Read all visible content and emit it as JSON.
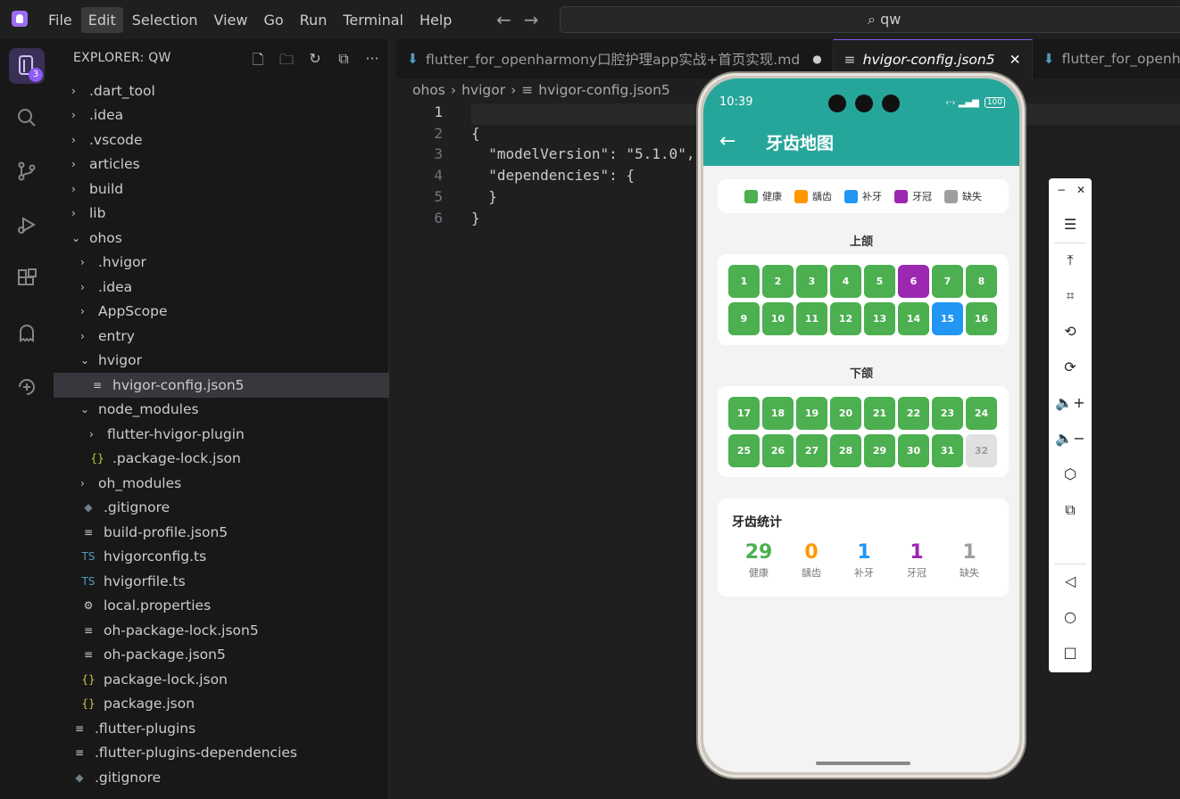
{
  "menu": [
    "File",
    "Edit",
    "Selection",
    "View",
    "Go",
    "Run",
    "Terminal",
    "Help"
  ],
  "search": {
    "value": "qw"
  },
  "activity": {
    "badge": "3"
  },
  "explorer": {
    "title": "EXPLORER: QW",
    "items": [
      {
        "label": ".dart_tool",
        "icon": "",
        "chev": "›"
      },
      {
        "label": ".idea",
        "icon": "",
        "chev": "›"
      },
      {
        "label": ".vscode",
        "icon": "",
        "chev": "›"
      },
      {
        "label": "articles",
        "icon": "",
        "chev": "›"
      },
      {
        "label": "build",
        "icon": "",
        "chev": "›"
      },
      {
        "label": "lib",
        "icon": "",
        "chev": "›"
      },
      {
        "label": "ohos",
        "icon": "",
        "chev": "⌄"
      },
      {
        "label": ".hvigor",
        "icon": "",
        "chev": "›"
      },
      {
        "label": ".idea",
        "icon": "",
        "chev": "›"
      },
      {
        "label": "AppScope",
        "icon": "",
        "chev": "›"
      },
      {
        "label": "entry",
        "icon": "",
        "chev": "›"
      },
      {
        "label": "hvigor",
        "icon": "",
        "chev": "⌄"
      },
      {
        "label": "hvigor-config.json5",
        "icon": "≡",
        "chev": ""
      },
      {
        "label": "node_modules",
        "icon": "",
        "chev": "⌄"
      },
      {
        "label": "flutter-hvigor-plugin",
        "icon": "",
        "chev": "›"
      },
      {
        "label": ".package-lock.json",
        "icon": "{}",
        "chev": ""
      },
      {
        "label": "oh_modules",
        "icon": "",
        "chev": "›"
      },
      {
        "label": ".gitignore",
        "icon": "◆",
        "chev": ""
      },
      {
        "label": "build-profile.json5",
        "icon": "≡",
        "chev": ""
      },
      {
        "label": "hvigorconfig.ts",
        "icon": "TS",
        "chev": ""
      },
      {
        "label": "hvigorfile.ts",
        "icon": "TS",
        "chev": ""
      },
      {
        "label": "local.properties",
        "icon": "⚙",
        "chev": ""
      },
      {
        "label": "oh-package-lock.json5",
        "icon": "≡",
        "chev": ""
      },
      {
        "label": "oh-package.json5",
        "icon": "≡",
        "chev": ""
      },
      {
        "label": "package-lock.json",
        "icon": "{}",
        "chev": ""
      },
      {
        "label": "package.json",
        "icon": "{}",
        "chev": ""
      },
      {
        "label": ".flutter-plugins",
        "icon": "≡",
        "chev": ""
      },
      {
        "label": ".flutter-plugins-dependencies",
        "icon": "≡",
        "chev": ""
      },
      {
        "label": ".gitignore",
        "icon": "◆",
        "chev": ""
      }
    ]
  },
  "tabs": [
    {
      "label": "flutter_for_openharmony口腔护理app实战+首页实现.md",
      "modified": "●"
    },
    {
      "label": "hvigor-config.json5",
      "close": "✕"
    },
    {
      "label": "flutter_for_openharm"
    }
  ],
  "breadcrumb": [
    "ohos",
    "hvigor",
    "hvigor-config.json5"
  ],
  "code": [
    {
      "n": "1",
      "t": ""
    },
    {
      "n": "2",
      "t": "{"
    },
    {
      "n": "3",
      "t": "  \"modelVersion\": \"5.1.0\","
    },
    {
      "n": "4",
      "t": "  \"dependencies\": {"
    },
    {
      "n": "5",
      "t": "  }"
    },
    {
      "n": "6",
      "t": "}"
    }
  ],
  "phone": {
    "time": "10:39",
    "battery": "100",
    "title": "牙齿地图",
    "legend": [
      {
        "label": "健康",
        "color": "#4caf50"
      },
      {
        "label": "龋齿",
        "color": "#ff9800"
      },
      {
        "label": "补牙",
        "color": "#2196f3"
      },
      {
        "label": "牙冠",
        "color": "#9c27b0"
      },
      {
        "label": "缺失",
        "color": "#9e9e9e"
      }
    ],
    "upper_label": "上颌",
    "lower_label": "下颌",
    "upper": [
      {
        "n": "1",
        "s": "healthy"
      },
      {
        "n": "2",
        "s": "healthy"
      },
      {
        "n": "3",
        "s": "healthy"
      },
      {
        "n": "4",
        "s": "healthy"
      },
      {
        "n": "5",
        "s": "healthy"
      },
      {
        "n": "6",
        "s": "crown"
      },
      {
        "n": "7",
        "s": "healthy"
      },
      {
        "n": "8",
        "s": "healthy"
      },
      {
        "n": "9",
        "s": "healthy"
      },
      {
        "n": "10",
        "s": "healthy"
      },
      {
        "n": "11",
        "s": "healthy"
      },
      {
        "n": "12",
        "s": "healthy"
      },
      {
        "n": "13",
        "s": "healthy"
      },
      {
        "n": "14",
        "s": "healthy"
      },
      {
        "n": "15",
        "s": "filled"
      },
      {
        "n": "16",
        "s": "healthy"
      }
    ],
    "lower": [
      {
        "n": "17",
        "s": "healthy"
      },
      {
        "n": "18",
        "s": "healthy"
      },
      {
        "n": "19",
        "s": "healthy"
      },
      {
        "n": "20",
        "s": "healthy"
      },
      {
        "n": "21",
        "s": "healthy"
      },
      {
        "n": "22",
        "s": "healthy"
      },
      {
        "n": "23",
        "s": "healthy"
      },
      {
        "n": "24",
        "s": "healthy"
      },
      {
        "n": "25",
        "s": "healthy"
      },
      {
        "n": "26",
        "s": "healthy"
      },
      {
        "n": "27",
        "s": "healthy"
      },
      {
        "n": "28",
        "s": "healthy"
      },
      {
        "n": "29",
        "s": "healthy"
      },
      {
        "n": "30",
        "s": "healthy"
      },
      {
        "n": "31",
        "s": "healthy"
      },
      {
        "n": "32",
        "s": "missing"
      }
    ],
    "status_colors": {
      "healthy": "#4caf50",
      "crown": "#9c27b0",
      "filled": "#2196f3",
      "missing": "#e0e0e0"
    },
    "stats_title": "牙齿统计",
    "stats": [
      {
        "value": "29",
        "label": "健康",
        "color": "#4caf50"
      },
      {
        "value": "0",
        "label": "龋齿",
        "color": "#ff9800"
      },
      {
        "value": "1",
        "label": "补牙",
        "color": "#2196f3"
      },
      {
        "value": "1",
        "label": "牙冠",
        "color": "#9c27b0"
      },
      {
        "value": "1",
        "label": "缺失",
        "color": "#9e9e9e"
      }
    ]
  }
}
